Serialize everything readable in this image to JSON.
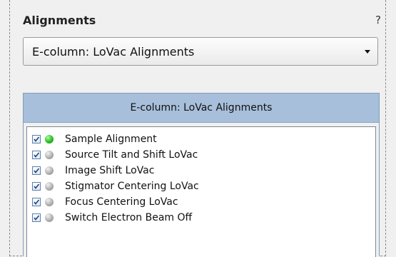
{
  "panel": {
    "title": "Alignments",
    "help": "?"
  },
  "dropdown": {
    "value": "E-column: LoVac Alignments"
  },
  "group": {
    "header": "E-column: LoVac Alignments",
    "items": [
      {
        "label": "Sample Alignment",
        "checked": true,
        "status": "green"
      },
      {
        "label": "Source Tilt and Shift LoVac",
        "checked": true,
        "status": "gray"
      },
      {
        "label": "Image Shift LoVac",
        "checked": true,
        "status": "gray"
      },
      {
        "label": "Stigmator Centering LoVac",
        "checked": true,
        "status": "gray"
      },
      {
        "label": "Focus Centering LoVac",
        "checked": true,
        "status": "gray"
      },
      {
        "label": "Switch Electron Beam Off",
        "checked": true,
        "status": "gray"
      }
    ]
  },
  "colors": {
    "header_bg": "#a7bfda",
    "status_done": "#3fd23a",
    "status_pending": "#bdbdbd"
  }
}
